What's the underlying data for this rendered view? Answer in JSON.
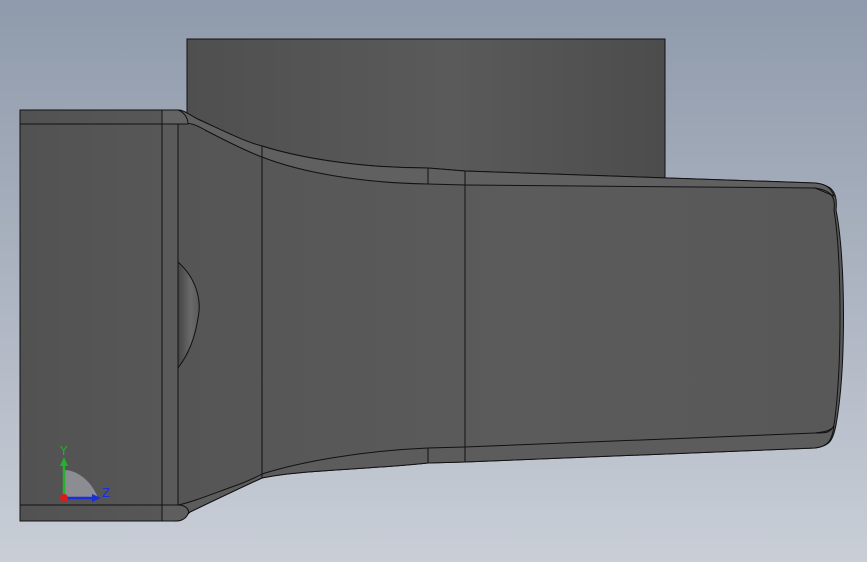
{
  "viewport": {
    "background_top": "#8f9aab",
    "background_bottom": "#c9ced7"
  },
  "model": {
    "face_color": "#575757",
    "face_light": "#5f5f5f",
    "face_dark": "#4a4a4a",
    "edge_color": "#111111",
    "fillet_light": "#7a7a7a"
  },
  "triad": {
    "y_label": "Y",
    "z_label": "Z",
    "y_color": "#22b22b",
    "z_color": "#1b2fd8",
    "x_color": "#d81b1b"
  }
}
